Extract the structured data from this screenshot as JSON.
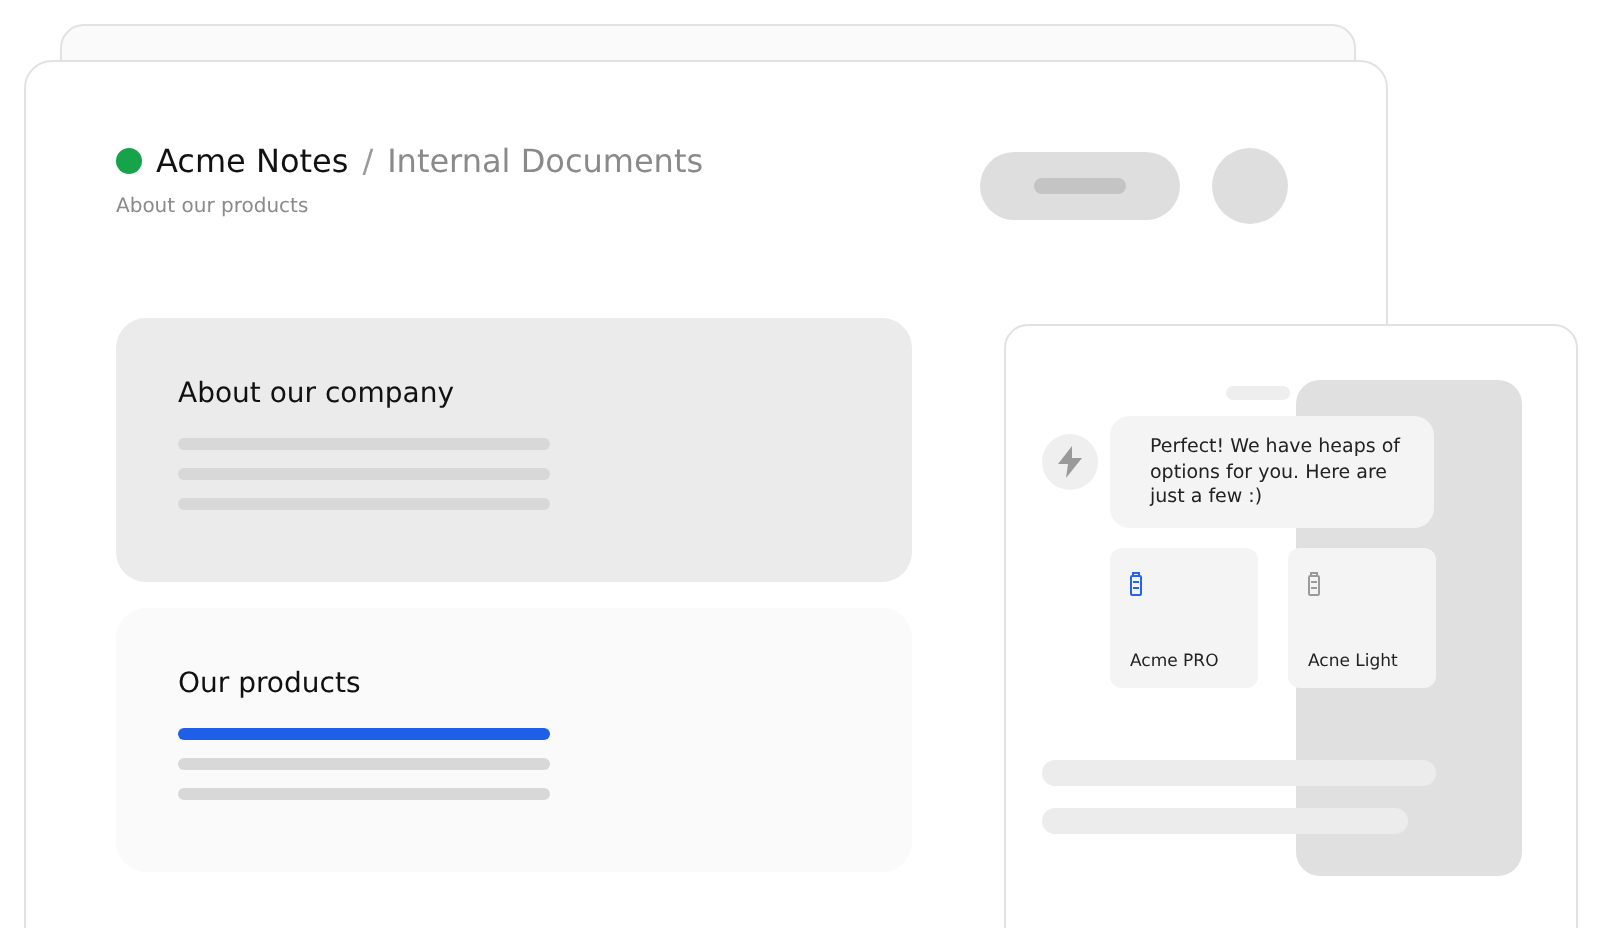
{
  "header": {
    "status": {
      "color": "#16a34a"
    },
    "app_name": "Acme Notes",
    "separator": "/",
    "section": "Internal Documents",
    "subtitle": "About our products"
  },
  "cards": [
    {
      "title": "About our company",
      "selected": true,
      "highlighted": false
    },
    {
      "title": "Our products",
      "selected": false,
      "highlighted": true
    }
  ],
  "chat": {
    "message": "Perfect! We have heaps of options for you. Here are just a few :)",
    "options": [
      {
        "label": "Acme PRO",
        "selected": true
      },
      {
        "label": "Acne Light",
        "selected": false
      }
    ]
  }
}
